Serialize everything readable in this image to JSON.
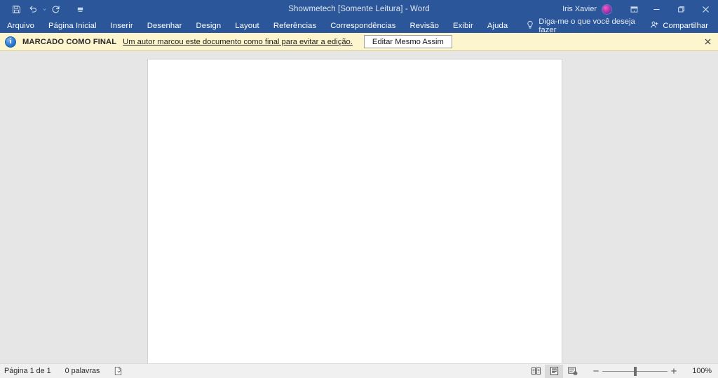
{
  "titlebar": {
    "quick_access": [
      {
        "name": "save-button",
        "icon": "save-icon",
        "label": "Salvar"
      },
      {
        "name": "undo-button",
        "icon": "undo-icon",
        "label": "Desfazer"
      },
      {
        "name": "redo-button",
        "icon": "redo-icon",
        "label": "Refazer"
      },
      {
        "name": "customize-qat-button",
        "icon": "chevron-down-icon",
        "label": "Personalizar Barra de Ferramentas de Acesso Rápido"
      }
    ],
    "document_title": "Showmetech [Somente Leitura]  -  Word",
    "user_name": "Iris Xavier",
    "ribbon_display_options_label": "Opções de Exibição da Faixa de Opções",
    "minimize_label": "Minimizar",
    "restore_label": "Restaurar Abaixo",
    "close_label": "Fechar",
    "background_color": "#2b579a"
  },
  "ribbon": {
    "tabs": [
      {
        "label": "Arquivo",
        "name": "tab-arquivo"
      },
      {
        "label": "Página Inicial",
        "name": "tab-pagina-inicial"
      },
      {
        "label": "Inserir",
        "name": "tab-inserir"
      },
      {
        "label": "Desenhar",
        "name": "tab-desenhar"
      },
      {
        "label": "Design",
        "name": "tab-design"
      },
      {
        "label": "Layout",
        "name": "tab-layout"
      },
      {
        "label": "Referências",
        "name": "tab-referencias"
      },
      {
        "label": "Correspondências",
        "name": "tab-correspondencias"
      },
      {
        "label": "Revisão",
        "name": "tab-revisao"
      },
      {
        "label": "Exibir",
        "name": "tab-exibir"
      },
      {
        "label": "Ajuda",
        "name": "tab-ajuda"
      }
    ],
    "tell_me_label": "Diga-me o que você deseja fazer",
    "share_label": "Compartilhar"
  },
  "message_bar": {
    "status_label": "MARCADO COMO FINAL",
    "description": "Um autor marcou este documento como final para evitar a edição.",
    "action_button": "Editar Mesmo Assim",
    "close_label": "Fechar",
    "background_color": "#fdf5ce",
    "info_icon_color": "#2d7dd2"
  },
  "statusbar": {
    "page_info": "Página 1 de 1",
    "word_count": "0 palavras",
    "proofing_label": "Status da verificação de texto",
    "views": [
      {
        "label": "Modo de Leitura",
        "name": "view-read-mode",
        "selected": false
      },
      {
        "label": "Layout de Impressão",
        "name": "view-print-layout",
        "selected": true
      },
      {
        "label": "Layout da Web",
        "name": "view-web-layout",
        "selected": false
      }
    ],
    "zoom_out_label": "Reduzir",
    "zoom_in_label": "Ampliar",
    "zoom_level": "100%",
    "zoom_value": 100
  },
  "document": {
    "page_background": "#ffffff",
    "workspace_background": "#e6e6e6",
    "body_text": ""
  }
}
